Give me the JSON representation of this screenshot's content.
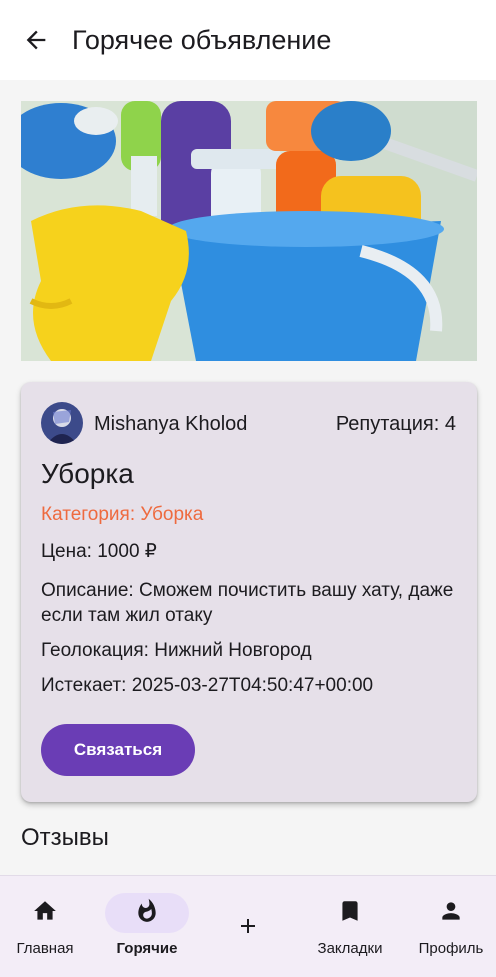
{
  "appbar": {
    "title": "Горячее объявление"
  },
  "ad": {
    "author": "Mishanya Kholod",
    "reputation": "Репутация: 4",
    "title": "Уборка",
    "category": "Категория: Уборка",
    "price": "Цена: 1000 ₽",
    "description": "Описание: Сможем почистить вашу хату, даже если там жил отаку",
    "location": "Геолокация: Нижний Новгород",
    "expires": "Истекает: 2025-03-27T04:50:47+00:00",
    "contact_label": "Связаться"
  },
  "reviews": {
    "heading": "Отзывы"
  },
  "nav": {
    "items": [
      {
        "label": "Главная",
        "icon": "home-icon"
      },
      {
        "label": "Горячие",
        "icon": "fire-icon",
        "active": true
      },
      {
        "label": "",
        "icon": "plus-icon"
      },
      {
        "label": "Закладки",
        "icon": "bookmark-icon"
      },
      {
        "label": "Профиль",
        "icon": "person-icon"
      }
    ]
  },
  "colors": {
    "accent": "#6a3db5",
    "category": "#ee6a3f",
    "card": "#e6e0e9",
    "nav": "#f3edf7",
    "active_pill": "#e8def8"
  }
}
